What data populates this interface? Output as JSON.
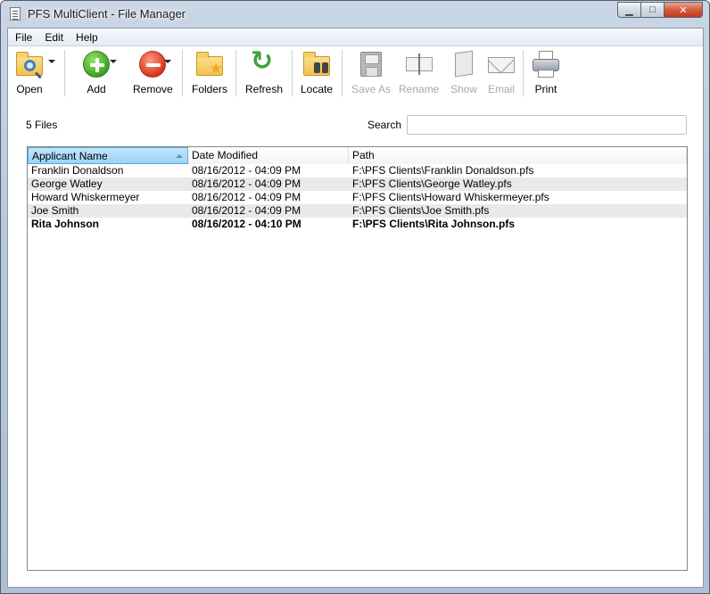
{
  "window": {
    "title": "PFS MultiClient - File Manager"
  },
  "menu": {
    "items": [
      "File",
      "Edit",
      "Help"
    ]
  },
  "toolbar": {
    "open": "Open",
    "add": "Add",
    "remove": "Remove",
    "folders": "Folders",
    "refresh": "Refresh",
    "locate": "Locate",
    "save_as": "Save As",
    "rename": "Rename",
    "show": "Show",
    "email": "Email",
    "print": "Print"
  },
  "summary": {
    "file_count": "5 Files"
  },
  "search": {
    "label": "Search",
    "value": ""
  },
  "table": {
    "columns": [
      "Applicant Name",
      "Date Modified",
      "Path"
    ],
    "sorted_column": "Applicant Name",
    "rows": [
      [
        "Franklin Donaldson",
        "08/16/2012 - 04:09 PM",
        "F:\\PFS Clients\\Franklin Donaldson.pfs"
      ],
      [
        "George Watley",
        "08/16/2012 - 04:09 PM",
        "F:\\PFS Clients\\George Watley.pfs"
      ],
      [
        "Howard Whiskermeyer",
        "08/16/2012 - 04:09 PM",
        "F:\\PFS Clients\\Howard Whiskermeyer.pfs"
      ],
      [
        "Joe Smith",
        "08/16/2012 - 04:09 PM",
        "F:\\PFS Clients\\Joe Smith.pfs"
      ],
      [
        "Rita Johnson",
        "08/16/2012 - 04:10 PM",
        "F:\\PFS Clients\\Rita Johnson.pfs"
      ]
    ],
    "bold_row_index": 4
  },
  "icons": {
    "open": "folder-search-icon",
    "add": "plus-circle-icon",
    "remove": "minus-circle-icon",
    "folders": "folder-star-icon",
    "refresh": "refresh-arrows-icon",
    "locate": "folder-binoculars-icon",
    "save_as": "floppy-disk-icon",
    "rename": "text-cursor-icon",
    "show": "document-icon",
    "email": "envelope-icon",
    "print": "printer-icon"
  },
  "colors": {
    "add": "#3aa51f",
    "remove": "#d9341c",
    "refresh": "#3fa33a",
    "sorted_header": "#9bd4f5",
    "alt_row": "#e9e9e9"
  }
}
